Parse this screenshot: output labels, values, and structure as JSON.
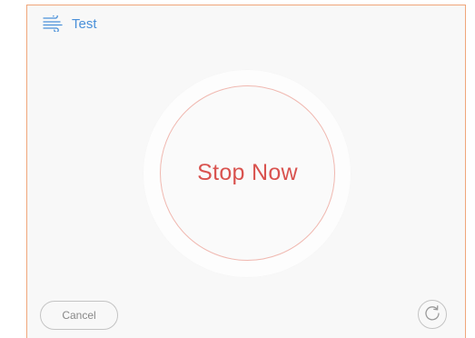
{
  "header": {
    "title": "Test",
    "icon": "wind-icon"
  },
  "main": {
    "stop_label": "Stop Now"
  },
  "footer": {
    "cancel_label": "Cancel",
    "refresh_icon": "refresh-icon"
  },
  "colors": {
    "accent_blue": "#4a90d9",
    "stop_red": "#d9534f",
    "ring_pink": "#f0b8b0",
    "panel_border_orange": "#f0a67a"
  }
}
